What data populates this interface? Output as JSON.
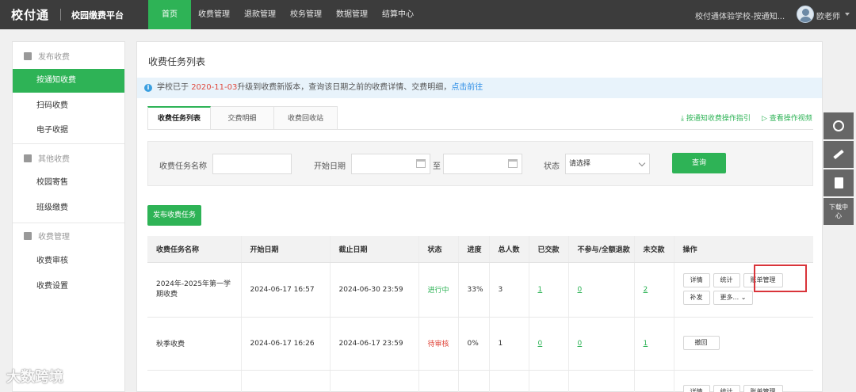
{
  "topbar": {
    "logo": "校付通",
    "platform": "校园缴费平台",
    "nav": [
      "首页",
      "收费管理",
      "退款管理",
      "校务管理",
      "数据管理",
      "结算中心"
    ],
    "school": "校付通体验学校-按通知...",
    "user": "欧老师"
  },
  "sidebar": {
    "group1": "发布收费",
    "group1_items": [
      "按通知收费",
      "扫码收费",
      "电子收据"
    ],
    "group2": "其他收费",
    "group2_items": [
      "校园寄售",
      "班级缴费"
    ],
    "group3": "收费管理",
    "group3_items": [
      "收费审核",
      "收费设置"
    ]
  },
  "main": {
    "title": "收费任务列表",
    "notice": {
      "prefix": "学校已于 ",
      "date": "2020-11-03",
      "middle": "升级到收费新版本，查询该日期之前的收费详情、交费明细，",
      "link": "点击前往"
    },
    "tabs": [
      "收费任务列表",
      "交费明细",
      "收费回收站"
    ],
    "guide1": "按通知收费操作指引",
    "guide2": "查看操作视频",
    "filter": {
      "name_label": "收费任务名称",
      "start_label": "开始日期",
      "to_label": "至",
      "status_label": "状态",
      "status_value": "请选择",
      "query_button": "查询"
    },
    "publish_button": "发布收费任务",
    "table": {
      "headers": [
        "收费任务名称",
        "开始日期",
        "截止日期",
        "状态",
        "进度",
        "总人数",
        "已交款",
        "不参与/全额退款",
        "未交款",
        "操作"
      ],
      "rows": [
        {
          "name": "2024年-2025年第一学期收费",
          "start": "2024-06-17 16:57",
          "end": "2024-06-30 23:59",
          "status": "进行中",
          "progress": "33%",
          "total": "3",
          "paid": "1",
          "refund": "0",
          "unpaid": "2",
          "ops": [
            "详情",
            "统计",
            "账单管理",
            "补发",
            "更多..."
          ]
        },
        {
          "name": "秋季收费",
          "start": "2024-06-17 16:26",
          "end": "2024-06-17 23:59",
          "status": "待审核",
          "progress": "0%",
          "total": "1",
          "paid": "0",
          "refund": "0",
          "unpaid": "1",
          "ops": [
            "撤回"
          ]
        },
        {
          "name": "",
          "start": "",
          "end": "",
          "status": "",
          "progress": "",
          "total": "",
          "paid": "",
          "refund": "",
          "unpaid": "",
          "ops": [
            "详情",
            "统计",
            "账单管理"
          ]
        }
      ]
    }
  },
  "rightbar": {
    "download": "下载中心"
  },
  "watermark": "大数跨境"
}
